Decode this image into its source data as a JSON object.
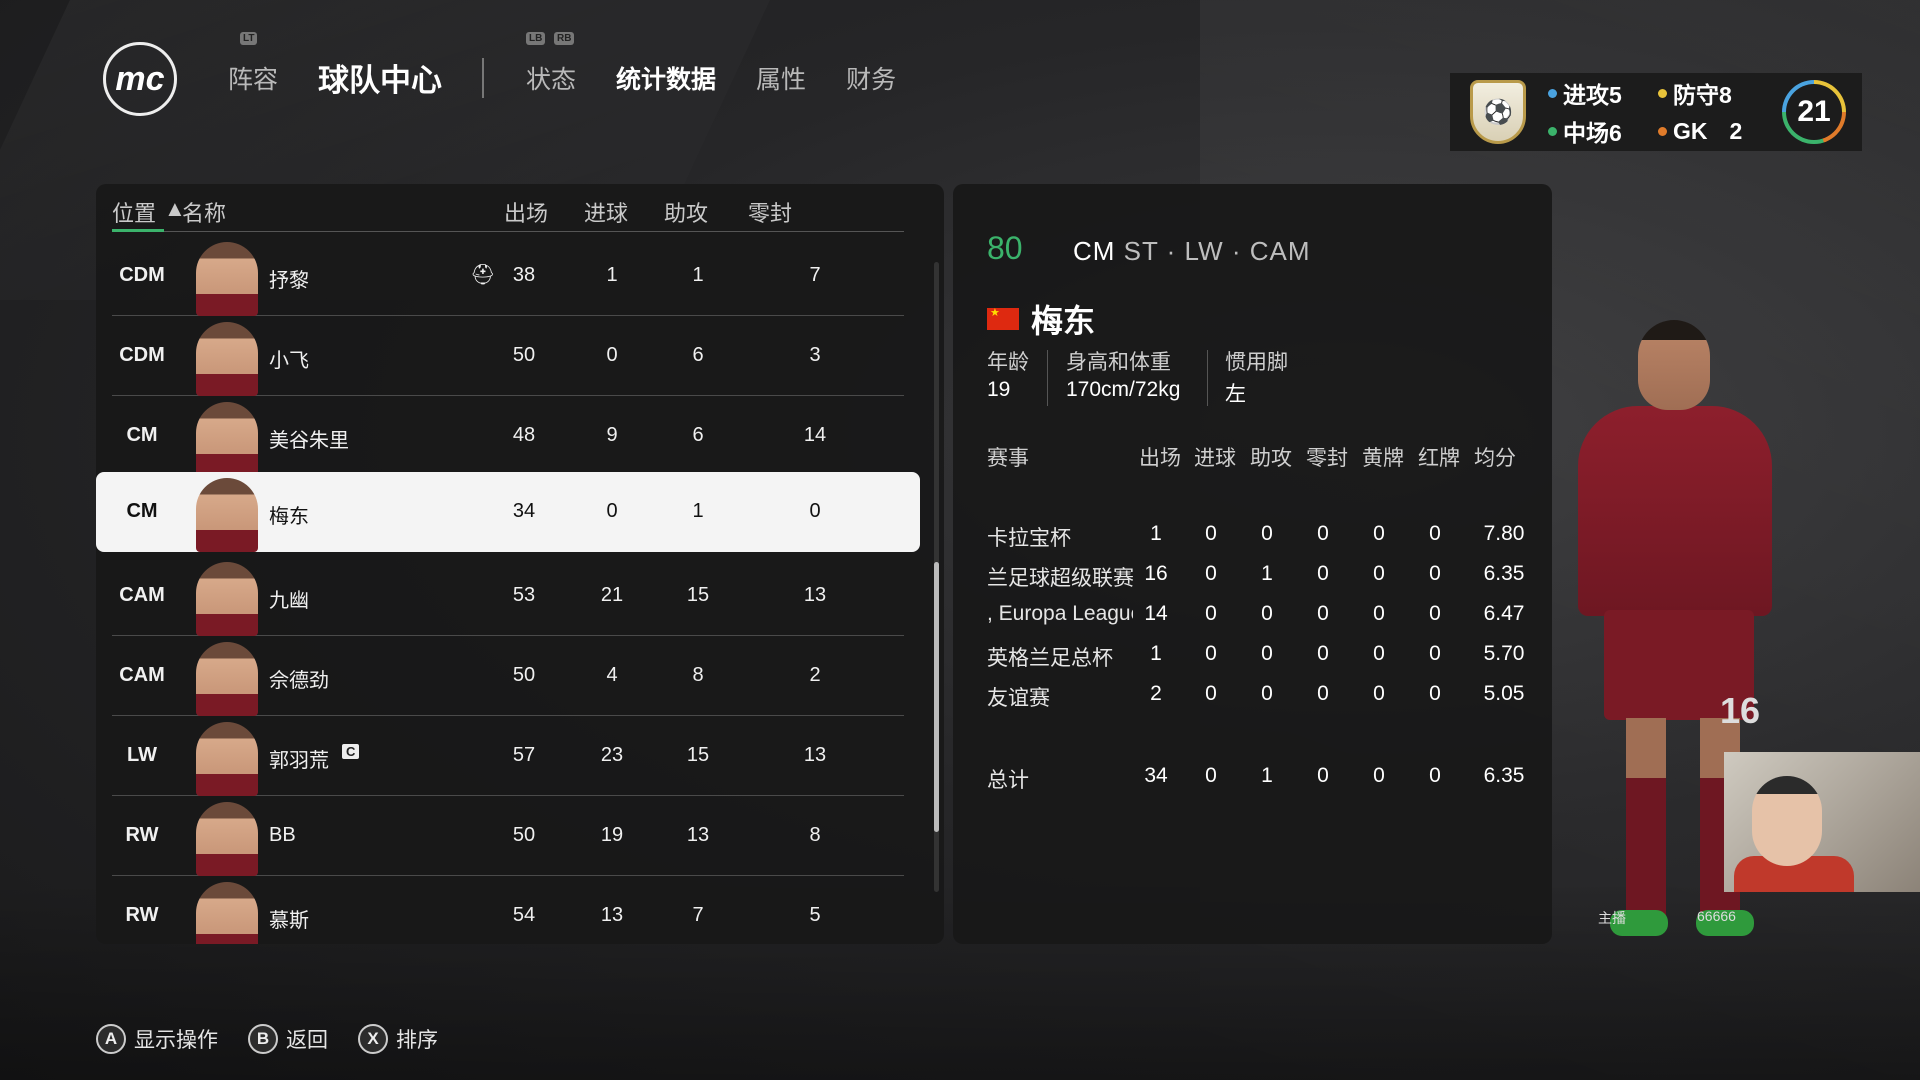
{
  "nav": {
    "logo": "mc",
    "items": [
      "阵容",
      "球队中心",
      "状态",
      "统计数据",
      "属性",
      "财务"
    ],
    "hints": [
      "LT",
      "LB",
      "RB"
    ]
  },
  "team_summary": {
    "attack_label": "进攻5",
    "defense_label": "防守8",
    "mid_label": "中场6",
    "gk_label": "GK",
    "gk_value": "2",
    "rating": "21",
    "colors": {
      "attack": "#4aa3e0",
      "defense": "#e8c33a",
      "mid": "#3bb36b",
      "gk": "#e07b2a"
    }
  },
  "list": {
    "headers": {
      "position": "位置",
      "sort_icon": "▲",
      "name": "名称",
      "apps": "出场",
      "goals": "进球",
      "assists": "助攻",
      "clean": "零封"
    },
    "rows": [
      {
        "pos": "CDM",
        "name": "抒黎",
        "apps": "38",
        "goals": "1",
        "assists": "1",
        "clean": "7",
        "icon": "injury-icon"
      },
      {
        "pos": "CDM",
        "name": "小飞",
        "apps": "50",
        "goals": "0",
        "assists": "6",
        "clean": "3"
      },
      {
        "pos": "CM",
        "name": "美谷朱里",
        "apps": "48",
        "goals": "9",
        "assists": "6",
        "clean": "14"
      },
      {
        "pos": "CM",
        "name": "梅东",
        "apps": "34",
        "goals": "0",
        "assists": "1",
        "clean": "0"
      },
      {
        "pos": "CAM",
        "name": "九幽",
        "apps": "53",
        "goals": "21",
        "assists": "15",
        "clean": "13"
      },
      {
        "pos": "CAM",
        "name": "佘德劲",
        "apps": "50",
        "goals": "4",
        "assists": "8",
        "clean": "2"
      },
      {
        "pos": "LW",
        "name": "郭羽荒",
        "apps": "57",
        "goals": "23",
        "assists": "15",
        "clean": "13",
        "icon": "captain-icon",
        "badge": "C"
      },
      {
        "pos": "RW",
        "name": "BB",
        "apps": "50",
        "goals": "19",
        "assists": "13",
        "clean": "8"
      },
      {
        "pos": "RW",
        "name": "慕斯",
        "apps": "54",
        "goals": "13",
        "assists": "7",
        "clean": "5"
      }
    ]
  },
  "detail": {
    "overall": "80",
    "positions": [
      "CM",
      "ST",
      "LW",
      "CAM"
    ],
    "name": "梅东",
    "age_label": "年龄",
    "age": "19",
    "hw_label": "身高和体重",
    "hw": "170cm/72kg",
    "foot_label": "惯用脚",
    "foot": "左",
    "stats_headers": [
      "赛事",
      "出场",
      "进球",
      "助攻",
      "零封",
      "黄牌",
      "红牌",
      "均分"
    ],
    "competitions": [
      {
        "name": "卡拉宝杯",
        "vals": [
          "1",
          "0",
          "0",
          "0",
          "0",
          "0",
          "7.80"
        ]
      },
      {
        "name": "兰足球超级联赛",
        "vals": [
          "16",
          "0",
          "1",
          "0",
          "0",
          "0",
          "6.35"
        ]
      },
      {
        "name": ", Europa League",
        "vals": [
          "14",
          "0",
          "0",
          "0",
          "0",
          "0",
          "6.47"
        ]
      },
      {
        "name": "英格兰足总杯",
        "vals": [
          "1",
          "0",
          "0",
          "0",
          "0",
          "0",
          "5.70"
        ]
      },
      {
        "name": "友谊赛",
        "vals": [
          "2",
          "0",
          "0",
          "0",
          "0",
          "0",
          "5.05"
        ]
      }
    ],
    "total": {
      "name": "总计",
      "vals": [
        "34",
        "0",
        "1",
        "0",
        "0",
        "0",
        "6.35"
      ]
    }
  },
  "player_figure": {
    "shirt_number": "16"
  },
  "overlay": {
    "host_label": "主播",
    "viewer_text": "66666"
  },
  "footer": [
    {
      "button": "A",
      "label": "显示操作"
    },
    {
      "button": "B",
      "label": "返回"
    },
    {
      "button": "X",
      "label": "排序"
    }
  ]
}
